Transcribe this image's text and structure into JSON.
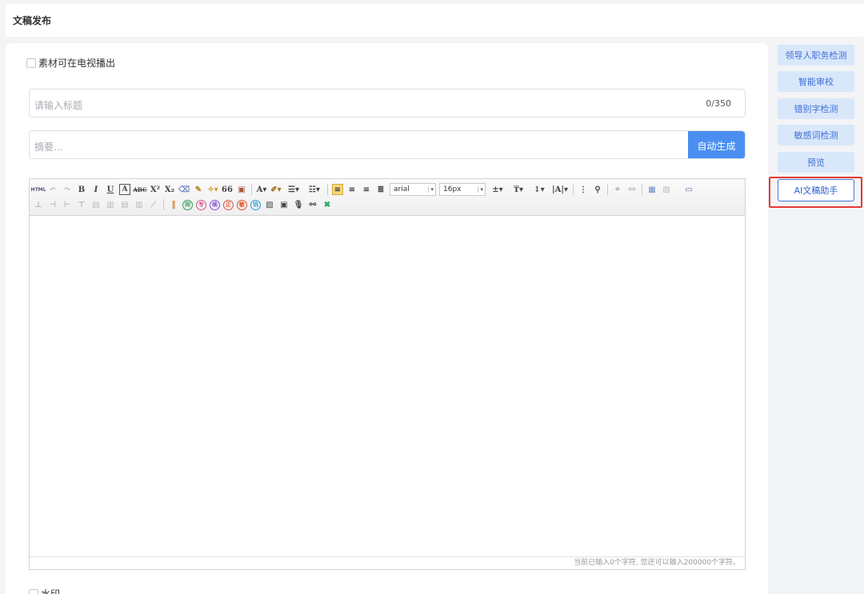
{
  "header": {
    "title": "文稿发布"
  },
  "form": {
    "tv_checkbox_label": "素材可在电视播出",
    "title_placeholder": "请输入标题",
    "title_count": "0/350",
    "summary_placeholder": "摘要...",
    "auto_generate_label": "自动生成",
    "watermark_label": "水印"
  },
  "editor": {
    "font_family": "arial",
    "font_size": "16px",
    "status_text": "当前已输入0个字符, 您还可以输入200000个字符。",
    "toolbar_icons": [
      "html-icon",
      "undo-icon",
      "redo-icon",
      "bold-icon",
      "italic-icon",
      "underline-icon",
      "font-border-icon",
      "strikethrough-icon",
      "superscript-icon",
      "subscript-icon",
      "eraser-icon",
      "format-brush-icon",
      "auto-format-icon",
      "blockquote-icon",
      "paste-plain-icon",
      "font-color-icon",
      "highlight-icon",
      "ordered-list-icon",
      "unordered-list-icon",
      "align-left-icon",
      "align-center-icon",
      "align-right-icon",
      "justify-icon",
      "letter-spacing-icon",
      "row-spacing-icon",
      "line-height-icon",
      "text-case-icon",
      "indent-icon",
      "find-replace-icon",
      "link-icon",
      "unlink-icon",
      "table-icon",
      "delete-table-icon",
      "fullscreen-icon"
    ],
    "labels": {
      "html": "HTML",
      "bold": "B",
      "italic": "I",
      "underline": "U",
      "font_border": "A",
      "strike": "ABC",
      "sup": "X²",
      "sub": "X₂",
      "quote": "66",
      "font_color": "A",
      "circ_tong": "同",
      "circ_zhuan": "专",
      "circ_xu": "续",
      "circ_zheng": "正",
      "circ_ci": "敏",
      "circ_xun": "讯"
    }
  },
  "sidebar": {
    "buttons": [
      "领导人职务检测",
      "智能审校",
      "错别字检测",
      "敏感词检测",
      "预览"
    ],
    "ai_button": "AI文稿助手"
  },
  "colors": {
    "primary": "#4a8ff0",
    "side_btn_bg": "#d9e7fb",
    "highlight": "#e53935"
  }
}
